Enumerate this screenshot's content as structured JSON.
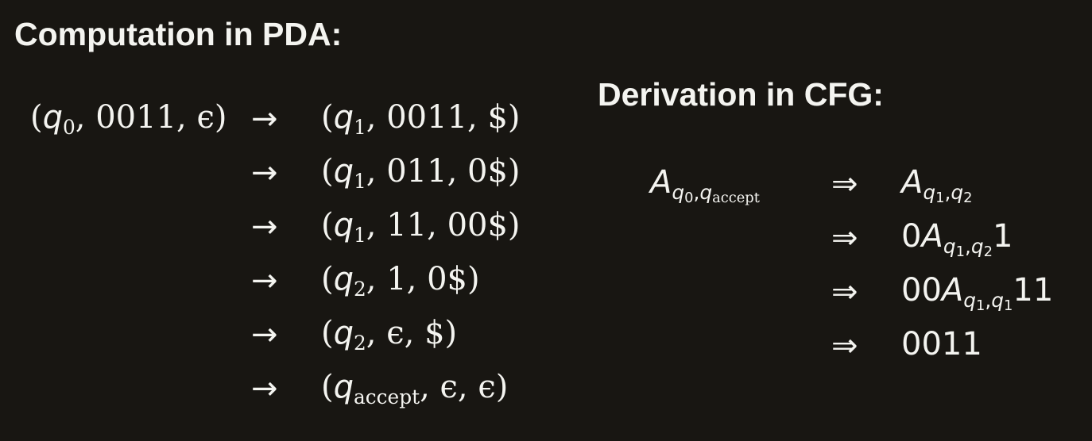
{
  "pda": {
    "heading": "Computation in PDA:",
    "arrow": "→",
    "start": {
      "state": "q",
      "sub": "0",
      "input": "0011",
      "stack": "ϵ"
    },
    "steps": [
      {
        "state": "q",
        "sub": "1",
        "input": "0011",
        "stack": "$"
      },
      {
        "state": "q",
        "sub": "1",
        "input": "011",
        "stack": "0$"
      },
      {
        "state": "q",
        "sub": "1",
        "input": "11",
        "stack": "00$"
      },
      {
        "state": "q",
        "sub": "2",
        "input": "1",
        "stack": "0$"
      },
      {
        "state": "q",
        "sub": "2",
        "input": "ϵ",
        "stack": "$"
      },
      {
        "state": "q",
        "sub": "accept",
        "input": "ϵ",
        "stack": "ϵ"
      }
    ]
  },
  "cfg": {
    "heading": "Derivation in CFG:",
    "arrow": "⇒",
    "start": {
      "var": "A",
      "sub1": "q",
      "sub1sub": "0",
      "sub2": "q",
      "sub2sub": "accept"
    },
    "steps": [
      {
        "prefix": "",
        "var": "A",
        "sub1": "q",
        "sub1sub": "1",
        "sub2": "q",
        "sub2sub": "2",
        "suffix": ""
      },
      {
        "prefix": "0",
        "var": "A",
        "sub1": "q",
        "sub1sub": "1",
        "sub2": "q",
        "sub2sub": "2",
        "suffix": "1"
      },
      {
        "prefix": "00",
        "var": "A",
        "sub1": "q",
        "sub1sub": "1",
        "sub2": "q",
        "sub2sub": "1",
        "suffix": "11"
      },
      {
        "prefix": "0011",
        "var": "",
        "sub1": "",
        "sub1sub": "",
        "sub2": "",
        "sub2sub": "",
        "suffix": ""
      }
    ]
  }
}
